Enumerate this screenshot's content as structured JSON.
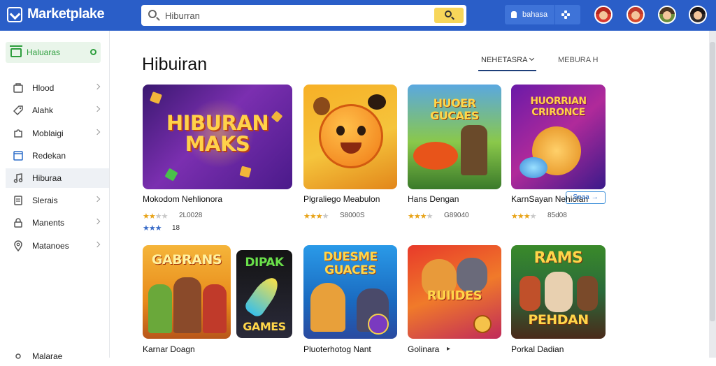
{
  "header": {
    "brand": "Marketplake",
    "search_value": "Hiburran",
    "account_label": "bahasa"
  },
  "sidebar": {
    "home_label": "Haluaras",
    "items": [
      {
        "label": "Hlood"
      },
      {
        "label": "Alahk"
      },
      {
        "label": "Moblaigi"
      },
      {
        "label": "Redekan"
      },
      {
        "label": "Hiburaa"
      },
      {
        "label": "Slerais"
      },
      {
        "label": "Manents"
      },
      {
        "label": "Matanoes"
      },
      {
        "label": "Malarae"
      }
    ]
  },
  "main": {
    "title": "Hibuiran",
    "sort_label": "NEHETASRA",
    "view_label": "MEBURA H",
    "see_all": "Seaa",
    "row1": [
      {
        "title": "Mokodom Nehlionora",
        "thumb_text": "HIBURAN MAKS",
        "rating": 2,
        "meta": "2L0028",
        "stars2": 3,
        "meta2": "18"
      },
      {
        "title": "Plgraliego Meabulon",
        "thumb_text": "",
        "rating": 3,
        "meta": "S8000S"
      },
      {
        "title": "Hans Dengan",
        "thumb_text": "HUOER GUCAES",
        "rating": 3,
        "meta": "G89040"
      },
      {
        "title": "KarnSayan Nehiolan",
        "thumb_text": "HUORRIAN CRIRONCE",
        "rating": 3,
        "meta": "85d08"
      }
    ],
    "row2": [
      {
        "title": "Karnar Doagn",
        "thumb_text": "GABRANS"
      },
      {
        "title": "",
        "thumb_text": "DIPAK GAMES"
      },
      {
        "title": "Pluoterhotog Nant",
        "thumb_text": "DUESME GUACES"
      },
      {
        "title": "Golinara",
        "thumb_text": "RUIIDES"
      },
      {
        "title": "Porkal Dadian",
        "thumb_text": "RAMS PEHDAN"
      }
    ]
  }
}
